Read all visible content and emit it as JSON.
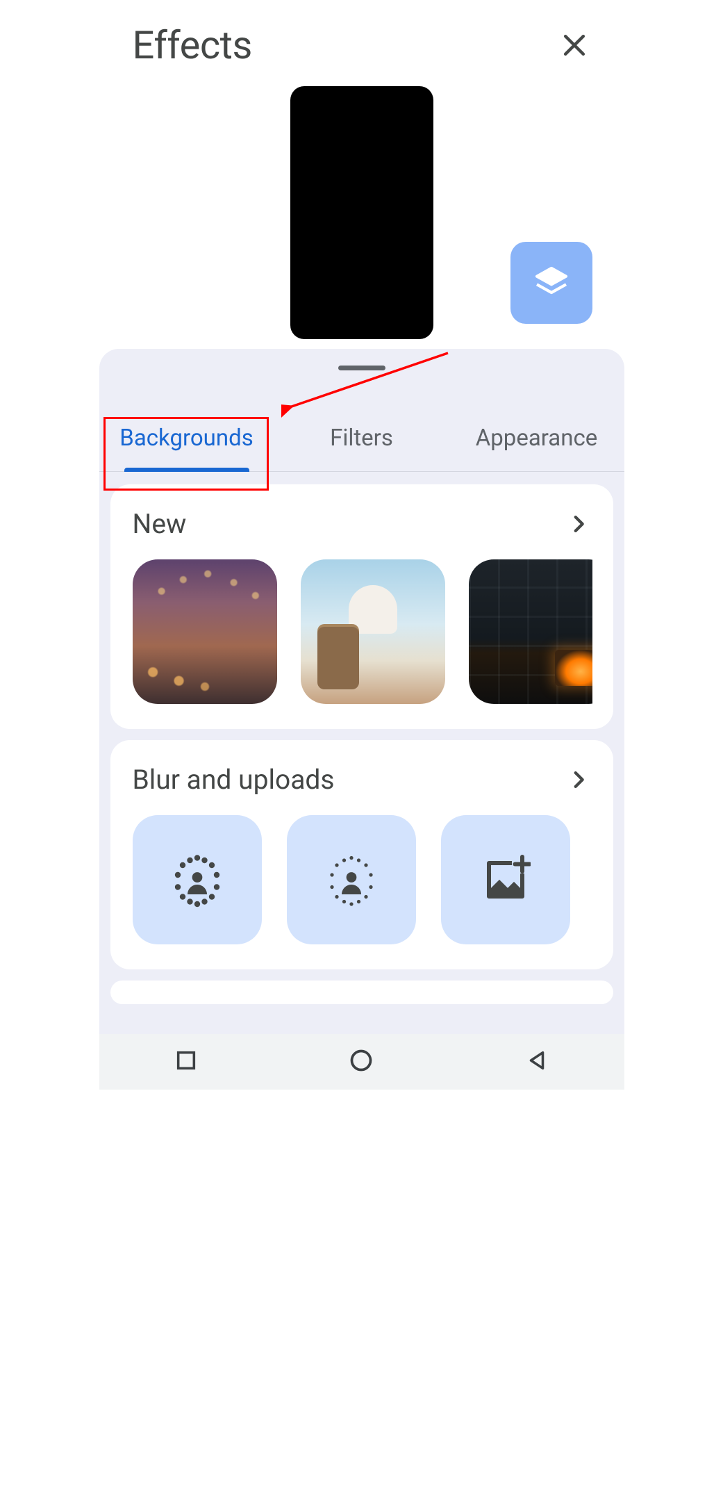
{
  "header": {
    "title": "Effects"
  },
  "tabs": {
    "backgrounds": "Backgrounds",
    "filters": "Filters",
    "appearance": "Appearance",
    "active": "backgrounds"
  },
  "sections": {
    "new": {
      "title": "New"
    },
    "blur": {
      "title": "Blur and uploads"
    }
  },
  "colors": {
    "accent": "#1967d2",
    "layers_button": "#8ab4f8",
    "option_tile": "#d3e3fd",
    "sheet_bg": "#edeef7",
    "annotation": "#ff0000"
  },
  "icons": {
    "close": "close-icon",
    "layers": "layers-icon",
    "chevron_right": "chevron-right-icon",
    "blur_strong": "blur-strong-icon",
    "blur_light": "blur-light-icon",
    "upload_image": "upload-image-icon",
    "nav_recents": "square-icon",
    "nav_home": "circle-icon",
    "nav_back": "triangle-back-icon"
  }
}
